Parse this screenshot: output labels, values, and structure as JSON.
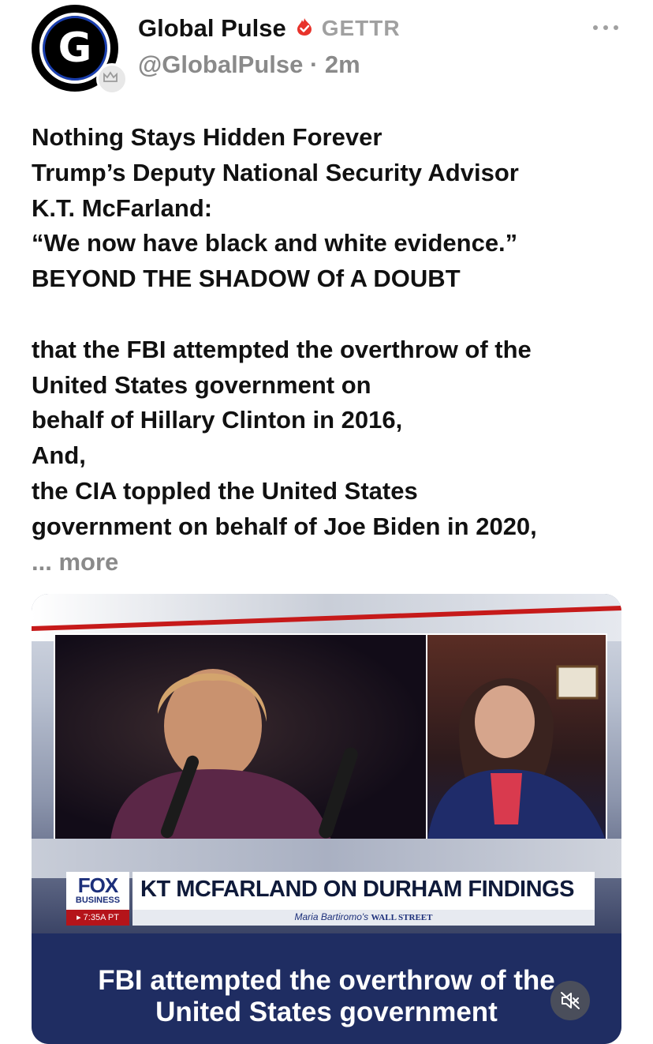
{
  "post": {
    "author": {
      "display_name": "Global Pulse",
      "platform": "GETTR",
      "handle_time": "@GlobalPulse · 2m",
      "avatar_letter": "G",
      "verified_icon": "flame-badge-icon",
      "avatar_badge_icon": "crown-badge-icon"
    },
    "menu_icon": "more-dots-icon",
    "text_lines": [
      "Nothing Stays Hidden Forever",
      "Trump’s Deputy National Security Advisor",
      "K.T. McFarland:",
      "“We now have black and white evidence.”",
      "BEYOND THE SHADOW Of A DOUBT",
      "",
      "that the FBI attempted the overthrow of the",
      "United States government on",
      "behalf of Hillary Clinton in 2016,",
      "And,",
      "the CIA toppled the United States",
      "government on behalf of Joe Biden in 2020,"
    ],
    "more_label": "... more"
  },
  "video": {
    "network_logo": "FOX",
    "network_sub": "BUSINESS",
    "time_chip": "▸ 7:35A PT",
    "headline": "KT MCFARLAND ON DURHAM FINDINGS",
    "show_name": "Maria Bartiromo's",
    "show_brand": "WALL STREET",
    "caption_lines": [
      "FBI attempted the overthrow of the",
      "United States government"
    ],
    "mute_icon": "speaker-muted-icon"
  },
  "colors": {
    "text": "#111111",
    "muted": "#8a8a8a",
    "flame": "#e8332b",
    "caption_band": "#1f2d62",
    "fox_blue": "#1c2f7a",
    "fox_red": "#b5141a"
  }
}
